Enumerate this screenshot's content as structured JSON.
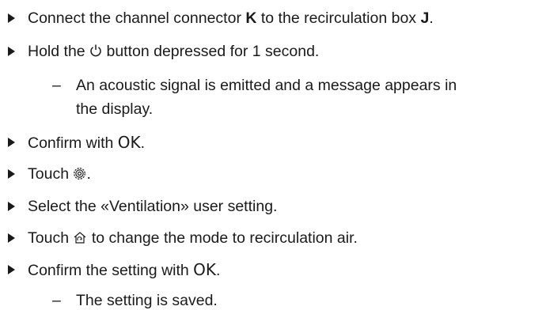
{
  "steps": {
    "s1": {
      "pre": "Connect the channel connector ",
      "k": "K",
      "mid": " to the recirculation box ",
      "j": "J",
      "end": "."
    },
    "s2": {
      "pre": "Hold the ",
      "icon": "power-icon",
      "post": " button depressed for 1 second."
    },
    "s2_result": {
      "dash": "–",
      "line1": "An acoustic signal is emitted and a message appears in",
      "line2": "the display."
    },
    "s3": {
      "pre": "Confirm with ",
      "ok": "OK",
      "end": "."
    },
    "s4": {
      "pre": "Touch ",
      "icon": "settings-icon",
      "end": "."
    },
    "s5": {
      "text": "Select the «Ventilation» user setting."
    },
    "s6": {
      "pre": "Touch ",
      "icon": "recirculation-icon",
      "post": " to change the mode to recirculation air."
    },
    "s7": {
      "pre": "Confirm the setting with ",
      "ok": "OK",
      "end": "."
    },
    "s7_result": {
      "dash": "–",
      "text": "The setting is saved."
    }
  }
}
